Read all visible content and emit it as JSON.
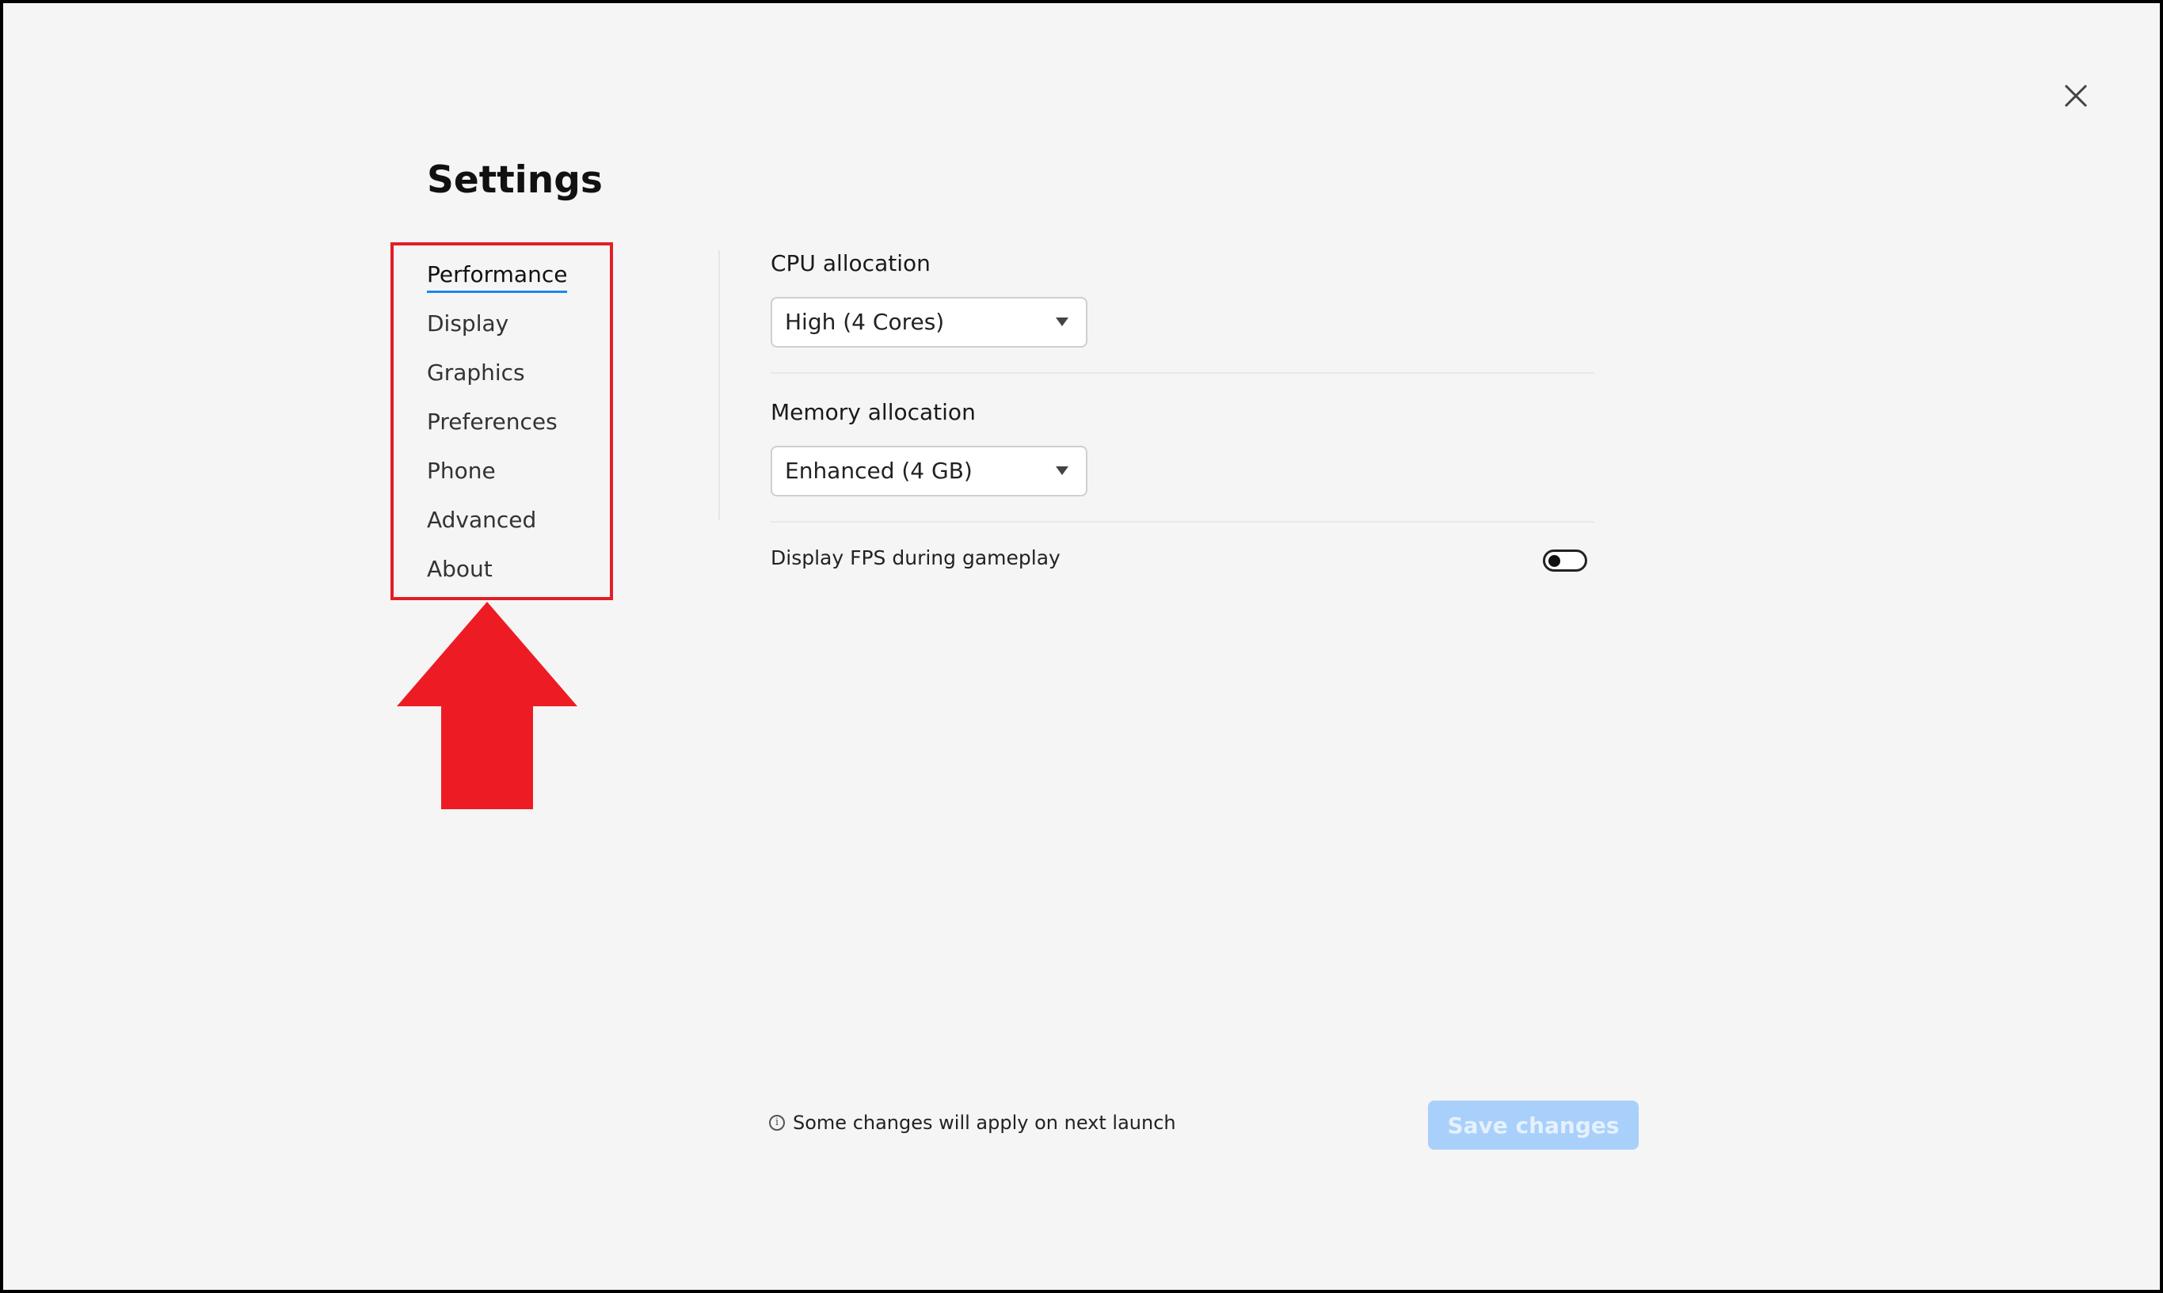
{
  "dialog": {
    "title": "Settings",
    "close_icon": "close-icon"
  },
  "nav": {
    "items": [
      {
        "label": "Performance",
        "active": true
      },
      {
        "label": "Display"
      },
      {
        "label": "Graphics"
      },
      {
        "label": "Preferences"
      },
      {
        "label": "Phone"
      },
      {
        "label": "Advanced"
      },
      {
        "label": "About"
      }
    ],
    "active_underline_color": "#1e88e5"
  },
  "annotation": {
    "highlight_color": "#e31e24",
    "arrow_color": "#ed1c24",
    "arrow_direction": "up"
  },
  "performance": {
    "cpu": {
      "label": "CPU allocation",
      "value": "High (4 Cores)"
    },
    "memory": {
      "label": "Memory allocation",
      "value": "Enhanced (4 GB)"
    },
    "fps": {
      "label": "Display FPS during gameplay",
      "enabled": false
    }
  },
  "footer": {
    "note_icon": "info-icon",
    "note": "Some changes will apply on next launch",
    "save_label": "Save changes",
    "save_enabled": false,
    "save_color": "#a8d0fb"
  }
}
